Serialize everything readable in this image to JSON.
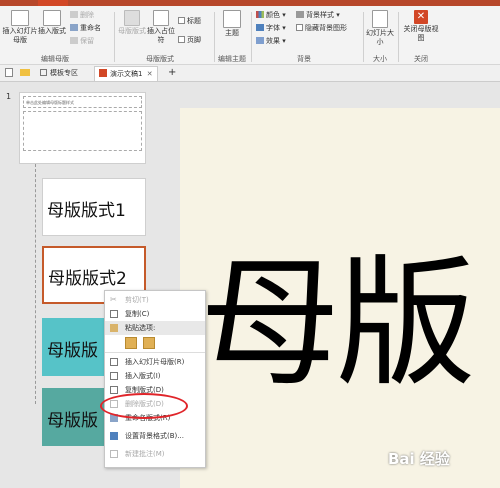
{
  "ribbon": {
    "insert_slide_master": "插入幻灯片母版",
    "insert_layout": "插入版式",
    "delete": "删除",
    "rename": "重命名",
    "preserve": "保留",
    "group_edit_master": "编辑母版",
    "master_layout": "母版版式",
    "insert_placeholder": "插入占位符",
    "title_check": "标题",
    "footer_check": "页脚",
    "group_master_layout": "母版版式",
    "theme": "主题",
    "group_edit_theme": "编辑主题",
    "colors": "颜色",
    "fonts": "字体",
    "effects": "效果",
    "background_styles": "背景样式",
    "hide_background_graphics": "隐藏背景图形",
    "group_background": "背景",
    "slide_size": "幻灯片大小",
    "group_size": "大小",
    "close_master_view": "关闭母版视图",
    "group_close": "关闭"
  },
  "tabs": {
    "templates": "模板专区",
    "document": "演示文稿1",
    "add": "+"
  },
  "slides": {
    "number": "1",
    "master_title": "单击此处编辑母版标题样式",
    "thumb2": "母版版式1",
    "thumb3": "母版版式2",
    "thumb4": "母版版",
    "thumb5": "母版版"
  },
  "canvas": {
    "big_text": "母版"
  },
  "context_menu": {
    "items": [
      {
        "label": "剪切(T)"
      },
      {
        "label": "复制(C)"
      },
      {
        "label": "粘贴选项:"
      },
      {
        "label": "插入幻灯片母版(R)"
      },
      {
        "label": "插入版式(I)"
      },
      {
        "label": "复制版式(D)"
      },
      {
        "label": "删除版式(D)"
      },
      {
        "label": "重命名版式(R)"
      },
      {
        "label": "设置背景格式(B)..."
      },
      {
        "label": "新建批注(M)"
      }
    ]
  },
  "watermark": "Bai 经验"
}
